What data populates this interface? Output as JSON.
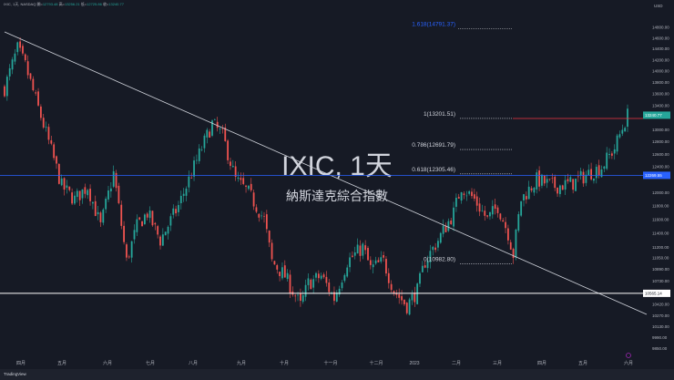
{
  "header": {
    "symbol": "IXIC, 1天, NASDAQ",
    "open_label": "開=",
    "open": "12793.48",
    "high_label": "高=",
    "high": "13256.21",
    "low_label": "低=",
    "low": "12725.86",
    "close_label": "收=",
    "close": "13240.77"
  },
  "watermark": {
    "title": "IXIC, 1天",
    "subtitle": "納斯達克綜合指數"
  },
  "currency": "USD",
  "footer": {
    "brand": "TradingView"
  },
  "colors": {
    "up": "#26a69a",
    "down": "#ef5350",
    "fib_blue": "#2962ff",
    "fib_red": "#f23645"
  },
  "chart_data": {
    "type": "candlestick",
    "scale": "log",
    "ylim": [
      9800,
      15000
    ],
    "y_ticks": [
      14800,
      14600,
      14400,
      14200,
      14000,
      13800,
      13600,
      13400,
      13000,
      12800,
      12600,
      12400,
      12000,
      11800,
      11600,
      11400,
      11200,
      11050,
      10890,
      10730,
      10420,
      10270,
      10130,
      9990,
      9850
    ],
    "x_ticks": [
      "四月",
      "五月",
      "六月",
      "七月",
      "八月",
      "九月",
      "十月",
      "十一月",
      "十二月",
      "2023",
      "二月",
      "三月",
      "四月",
      "五月",
      "六月"
    ],
    "price_path": [
      [
        0,
        13700
      ],
      [
        5,
        14400
      ],
      [
        8,
        14100
      ],
      [
        12,
        13500
      ],
      [
        17,
        12800
      ],
      [
        22,
        12100
      ],
      [
        27,
        11900
      ],
      [
        32,
        12100
      ],
      [
        37,
        11500
      ],
      [
        42,
        12300
      ],
      [
        47,
        11000
      ],
      [
        51,
        11500
      ],
      [
        55,
        11700
      ],
      [
        60,
        11300
      ],
      [
        67,
        11800
      ],
      [
        72,
        12300
      ],
      [
        76,
        12700
      ],
      [
        80,
        13100
      ],
      [
        84,
        12900
      ],
      [
        89,
        12200
      ],
      [
        94,
        12000
      ],
      [
        100,
        11600
      ],
      [
        103,
        11000
      ],
      [
        108,
        10800
      ],
      [
        114,
        10400
      ],
      [
        117,
        10700
      ],
      [
        122,
        10800
      ],
      [
        127,
        10500
      ],
      [
        132,
        11000
      ],
      [
        138,
        11200
      ],
      [
        141,
        10900
      ],
      [
        146,
        11000
      ],
      [
        150,
        10600
      ],
      [
        155,
        10400
      ],
      [
        159,
        10600
      ],
      [
        162,
        11000
      ],
      [
        167,
        11300
      ],
      [
        173,
        11700
      ],
      [
        176,
        12100
      ],
      [
        181,
        11900
      ],
      [
        186,
        11600
      ],
      [
        190,
        11800
      ],
      [
        194,
        11400
      ],
      [
        196,
        11100
      ],
      [
        199,
        11900
      ],
      [
        205,
        12200
      ],
      [
        212,
        12100
      ],
      [
        219,
        12150
      ],
      [
        225,
        12300
      ],
      [
        230,
        12400
      ],
      [
        235,
        12700
      ],
      [
        240,
        13240
      ]
    ],
    "last_price": "13240.77",
    "support_level": "10565.14",
    "blue_level": "12269.55",
    "fib_levels": [
      {
        "label": "1.618(14791.37)",
        "price": 14791.37,
        "color": "#2962ff"
      },
      {
        "label": "1(13201.51)",
        "price": 13201.51,
        "color": "#d1d4dc"
      },
      {
        "label": "0.786(12691.79)",
        "price": 12691.79,
        "color": "#d1d4dc"
      },
      {
        "label": "0.618(12305.46)",
        "price": 12305.46,
        "color": "#d1d4dc"
      },
      {
        "label": "0(10982.80)",
        "price": 10982.8,
        "color": "#d1d4dc"
      }
    ]
  }
}
